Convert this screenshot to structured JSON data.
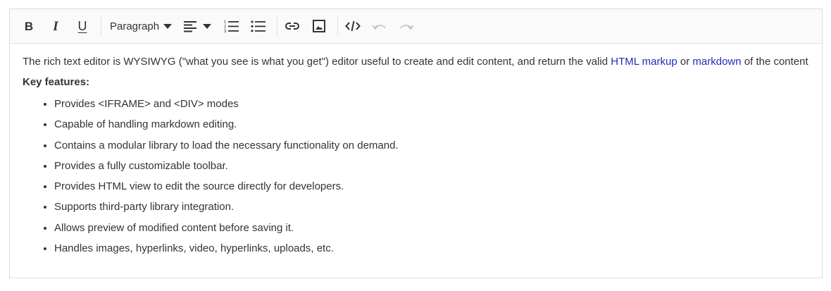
{
  "toolbar": {
    "bold_label": "B",
    "italic_label": "I",
    "underline_label": "U",
    "format_selected": "Paragraph",
    "icons": [
      "bold-icon",
      "italic-icon",
      "underline-icon",
      "chevron-down-icon",
      "align-left-icon",
      "ordered-list-icon",
      "unordered-list-icon",
      "link-icon",
      "image-icon",
      "source-code-icon",
      "undo-icon",
      "redo-icon"
    ]
  },
  "content": {
    "intro_before": "The rich text editor is WYSIWYG (\"what you see is what you get\") editor useful to create and edit content, and return the valid ",
    "link1": "HTML markup",
    "between": " or ",
    "link2": "markdown",
    "intro_after": " of the content",
    "features_title": "Key features:",
    "features": [
      "Provides <IFRAME> and <DIV> modes",
      "Capable of handling markdown editing.",
      "Contains a modular library to load the necessary functionality on demand.",
      "Provides a fully customizable toolbar.",
      "Provides HTML view to edit the source directly for developers.",
      "Supports third-party library integration.",
      "Allows preview of modified content before saving it.",
      "Handles images, hyperlinks, video, hyperlinks, uploads, etc."
    ]
  },
  "colors": {
    "link": "#1d2fb4",
    "text": "#333333",
    "disabled": "#c4c4c4",
    "toolbar_bg": "#fafafa"
  }
}
